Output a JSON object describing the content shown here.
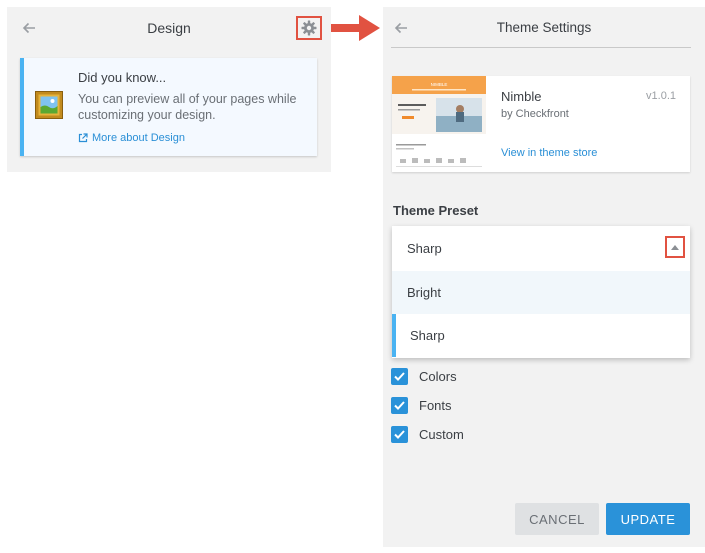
{
  "colors": {
    "accent": "#2a92d9",
    "link": "#2a8fd6",
    "highlight_border": "#e15241",
    "card_stripe": "#4ab3f2",
    "panel_bg": "#f2f2f2"
  },
  "design_panel": {
    "back_icon": "arrow-left-icon",
    "title": "Design",
    "settings_icon": "gear-icon",
    "tip": {
      "icon": "picture-frame-icon",
      "title": "Did you know...",
      "body": "You can preview all of your pages while customizing your design.",
      "link_icon": "external-link-icon",
      "link_label": "More about Design"
    }
  },
  "flow_arrow_icon": "arrow-right-icon",
  "theme_settings_panel": {
    "back_icon": "arrow-left-icon",
    "title": "Theme Settings",
    "theme": {
      "name": "Nimble",
      "version": "v1.0.1",
      "author": "by Checkfront",
      "store_link": "View in theme store",
      "thumbnail_brand": "NIMBLE"
    },
    "preset": {
      "label": "Theme Preset",
      "selected": "Sharp",
      "caret_icon": "caret-up-icon",
      "options": [
        {
          "label": "Bright",
          "state": "hover"
        },
        {
          "label": "Sharp",
          "state": "selected"
        }
      ]
    },
    "checkboxes": [
      {
        "label": "Colors",
        "checked": true
      },
      {
        "label": "Fonts",
        "checked": true
      },
      {
        "label": "Custom",
        "checked": true
      }
    ],
    "buttons": {
      "cancel": "CANCEL",
      "update": "UPDATE"
    }
  }
}
